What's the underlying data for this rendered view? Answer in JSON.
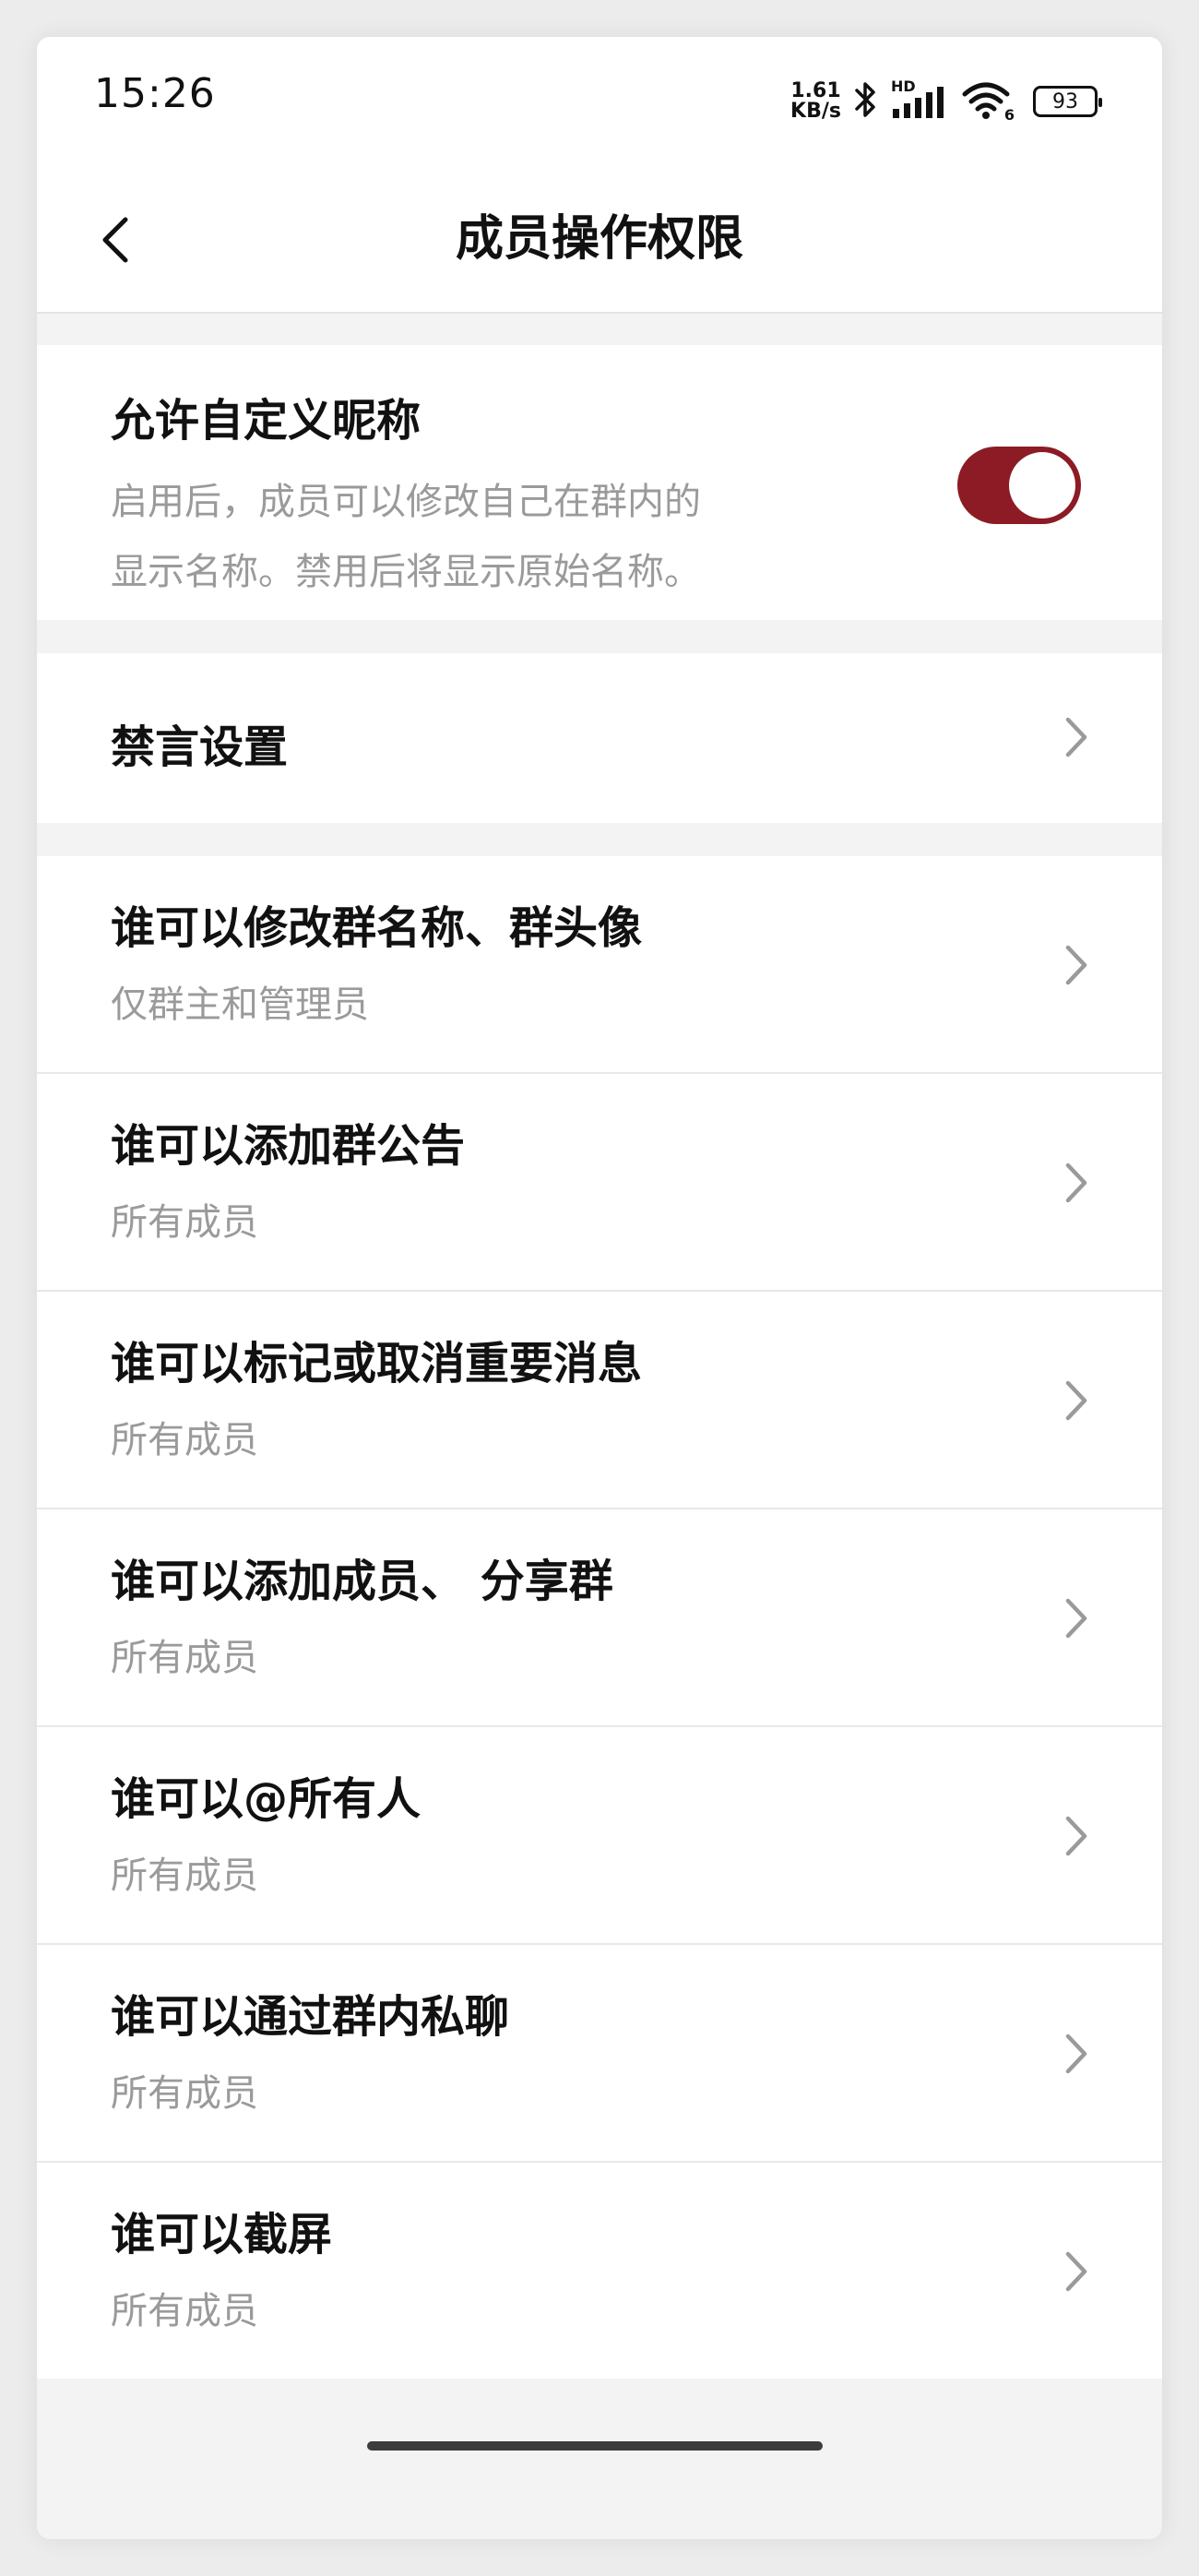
{
  "status_bar": {
    "time": "15:26",
    "net_speed_value": "1.61",
    "net_speed_unit": "KB/s",
    "signal_badge": "HD",
    "wifi_badge": "6",
    "battery": "93"
  },
  "header": {
    "title": "成员操作权限"
  },
  "nickname_setting": {
    "title": "允许自定义昵称",
    "description_line1": "启用后，成员可以修改自己在群内的",
    "description_line2": "显示名称。禁用后将显示原始名称。",
    "enabled": true
  },
  "mute_setting": {
    "title": "禁言设置"
  },
  "permissions": [
    {
      "title": "谁可以修改群名称、群头像",
      "value": "仅群主和管理员"
    },
    {
      "title": "谁可以添加群公告",
      "value": "所有成员"
    },
    {
      "title": "谁可以标记或取消重要消息",
      "value": "所有成员"
    },
    {
      "title": "谁可以添加成员、 分享群",
      "value": "所有成员"
    },
    {
      "title": "谁可以@所有人",
      "value": "所有成员"
    },
    {
      "title": "谁可以通过群内私聊",
      "value": "所有成员"
    },
    {
      "title": "谁可以截屏",
      "value": "所有成员"
    }
  ],
  "colors": {
    "accent": "#8c1b25",
    "background": "#f3f3f3",
    "card": "#ffffff",
    "primary_text": "#111111",
    "secondary_text": "#9a9a9a"
  }
}
